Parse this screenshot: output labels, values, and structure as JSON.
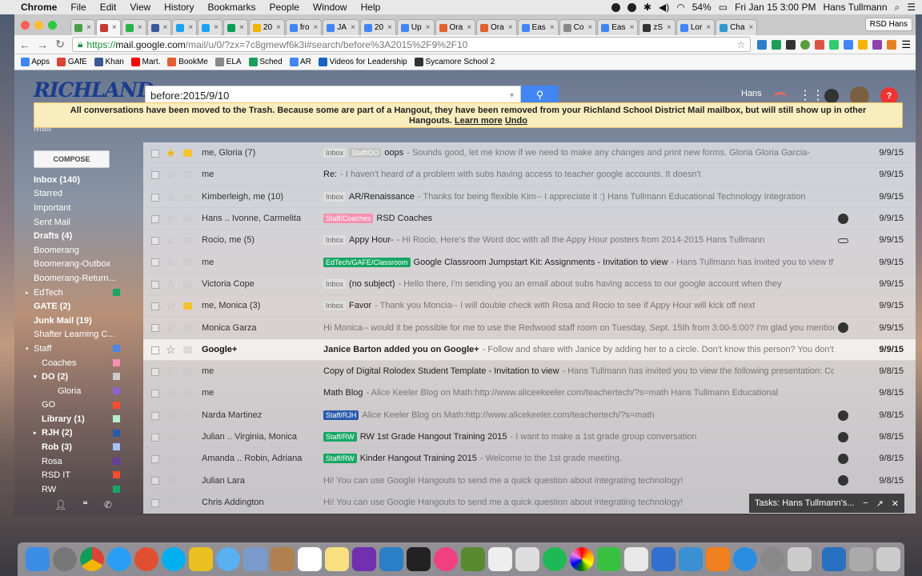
{
  "menubar": {
    "app": "Chrome",
    "items": [
      "File",
      "Edit",
      "View",
      "History",
      "Bookmarks",
      "People",
      "Window",
      "Help"
    ],
    "battery": "54%",
    "clock": "Fri Jan 15  3:00 PM",
    "user": "Hans Tullmann"
  },
  "tabs": [
    {
      "label": "",
      "color": "#4aa04a"
    },
    {
      "label": "",
      "color": "#c5392f"
    },
    {
      "label": "",
      "color": "#2bb24c"
    },
    {
      "label": "",
      "color": "#3b5998"
    },
    {
      "label": "",
      "color": "#1da1f2"
    },
    {
      "label": "",
      "color": "#1da1f2"
    },
    {
      "label": "",
      "color": "#0f9d58"
    },
    {
      "label": "20",
      "color": "#f4b400"
    },
    {
      "label": "fro",
      "color": "#4285f4"
    },
    {
      "label": "JA",
      "color": "#4285f4"
    },
    {
      "label": "20",
      "color": "#4285f4"
    },
    {
      "label": "Up",
      "color": "#4285f4"
    },
    {
      "label": "Ora",
      "color": "#e06030"
    },
    {
      "label": "Ora",
      "color": "#e06030"
    },
    {
      "label": "Eas",
      "color": "#4285f4"
    },
    {
      "label": "Co",
      "color": "#888"
    },
    {
      "label": "Eas",
      "color": "#4285f4"
    },
    {
      "label": "zS",
      "color": "#333"
    },
    {
      "label": "Lor",
      "color": "#4285f4"
    },
    {
      "label": "Cha",
      "color": "#3399cc"
    }
  ],
  "profile_button": "RSD Hans",
  "url": {
    "scheme": "https://",
    "host": "mail.google.com",
    "path": "/mail/u/0/?zx=7c8gmewf6k3i#search/before%3A2015%2F9%2F10"
  },
  "bookmarks": [
    "Apps",
    "GAfE",
    "Khan",
    "Mart.",
    "BookMe",
    "ELA",
    "Sched",
    "AR",
    "Videos for Leadership",
    "Sycamore School 2"
  ],
  "gmail": {
    "logo": "RICHLAND",
    "mail_word": "Mail",
    "search_value": "before:2015/9/10",
    "user_name": "Hans",
    "banner": {
      "text": "All conversations have been moved to the Trash. Because some are part of a Hangout, they have been removed from your Richland School District Mail mailbox, but will still show up in other Hangouts.",
      "learn": "Learn more",
      "undo": "Undo"
    },
    "compose": "COMPOSE",
    "labels": [
      {
        "name": "Inbox (140)",
        "bold": true
      },
      {
        "name": "Starred"
      },
      {
        "name": "Important"
      },
      {
        "name": "Sent Mail"
      },
      {
        "name": "Drafts (4)",
        "bold": true
      },
      {
        "name": "Boomerang"
      },
      {
        "name": "Boomerang-Outbox"
      },
      {
        "name": "Boomerang-Return..."
      },
      {
        "name": "EdTech",
        "color": "#16a765",
        "arrow": "▸"
      },
      {
        "name": "GATE (2)",
        "bold": true
      },
      {
        "name": "Junk Mail (19)",
        "bold": true
      },
      {
        "name": "Shafter Learning C..."
      },
      {
        "name": "Staff",
        "color": "#4986e7",
        "arrow": "▾"
      },
      {
        "name": "Coaches",
        "color": "#f691b2",
        "indent": 1
      },
      {
        "name": "DO (2)",
        "bold": true,
        "color": "#cccccc",
        "indent": 1,
        "arrow": "▾"
      },
      {
        "name": "Gloria",
        "color": "#8e63ce",
        "indent": 2
      },
      {
        "name": "GO",
        "color": "#fb4c2f",
        "indent": 1
      },
      {
        "name": "Library (1)",
        "bold": true,
        "color": "#b3efd3",
        "indent": 1
      },
      {
        "name": "RJH (2)",
        "bold": true,
        "color": "#285bac",
        "indent": 1,
        "arrow": "▸"
      },
      {
        "name": "Rob (3)",
        "bold": true,
        "color": "#a4c2f4",
        "indent": 1
      },
      {
        "name": "Rosa",
        "color": "#653e9b",
        "indent": 1
      },
      {
        "name": "RSD IT",
        "color": "#fb4c2f",
        "indent": 1
      },
      {
        "name": "RW",
        "color": "#16a765",
        "indent": 1
      }
    ],
    "emails": [
      {
        "sender": "me, Gloria (7)",
        "starred": true,
        "important": true,
        "tags": [
          {
            "text": "Inbox",
            "cls": "gray"
          },
          {
            "text": "Staff/DO",
            "cls": "lgray"
          }
        ],
        "subject": "oops",
        "snippet": " - Sounds good, let me know if we need to make any changes and print new forms. Gloria Gloria Garcia-",
        "date": "9/9/15"
      },
      {
        "sender": "me",
        "tags": [],
        "subject": "Re:",
        "snippet": " - I haven't heard of a problem with subs having access to teacher google accounts. It doesn't",
        "date": "9/9/15"
      },
      {
        "sender": "Kimberleigh, me (10)",
        "tags": [
          {
            "text": "Inbox",
            "cls": "gray"
          }
        ],
        "subject": "AR/Renaissance",
        "snippet": " - Thanks for being flexible Kim-- I appreciate it :) Hans Tullmann Educational Technology Integration",
        "date": "9/9/15"
      },
      {
        "sender": "Hans .. Ivonne, Carmelita",
        "tags": [
          {
            "text": "Staff/Coaches",
            "cls": "pink"
          }
        ],
        "subject": "RSD Coaches",
        "snippet": "",
        "date": "9/9/15",
        "att": "dot"
      },
      {
        "sender": "Rocio, me (5)",
        "tags": [
          {
            "text": "Inbox",
            "cls": "gray"
          }
        ],
        "subject": "Appy Hour-",
        "snippet": " - Hi Rocio, Here's the Word doc with all the Appy Hour posters from 2014-2015 Hans Tullmann",
        "date": "9/9/15",
        "att": "clip"
      },
      {
        "sender": "me",
        "tags": [
          {
            "text": "EdTech/GAFE/Classroom",
            "cls": "green"
          }
        ],
        "subject": "Google Classroom Jumpstart Kit: Assignments - Invitation to view",
        "snippet": " - Hans Tullmann has invited you to view the follo",
        "date": "9/9/15"
      },
      {
        "sender": "Victoria Cope",
        "tags": [
          {
            "text": "Inbox",
            "cls": "gray"
          }
        ],
        "subject": "(no subject)",
        "snippet": " - Hello there, I'm sending you an email about subs having access to our google account when they",
        "date": "9/9/15"
      },
      {
        "sender": "me, Monica (3)",
        "important": true,
        "tags": [
          {
            "text": "Inbox",
            "cls": "gray"
          }
        ],
        "subject": "Favor",
        "snippet": " - Thank you Moncia-- I will double check with Rosa and Rocio to see if Appy Hour will kick off next",
        "date": "9/9/15"
      },
      {
        "sender": "Monica Garza",
        "tags": [],
        "subject": "",
        "snippet": "Hi Monica-- would it be possible for me to use the Redwood staff room on Tuesday, Sept. 15th from 3:00-5:00?  I'm glad you mentioned the g",
        "date": "9/9/15",
        "att": "dot"
      },
      {
        "sender": "Google+",
        "unread": true,
        "tags": [],
        "subject": "Janice Barton added you on Google+",
        "snippet": " - Follow and share with Janice by adding her to a circle. Don't know this person? You don't",
        "date": "9/9/15"
      },
      {
        "sender": "me",
        "tags": [],
        "subject": "Copy of Digital Rolodex Student Template - Invitation to view",
        "snippet": " - Hans Tullmann has invited you to view the following presentation: Copy of Dig",
        "date": "9/8/15"
      },
      {
        "sender": "me",
        "tags": [],
        "subject": "Math Blog",
        "snippet": " - Alice Keeler Blog on Math:http://www.aliceekeeler.com/teachertech/?s=math Hans Tullmann Educational",
        "date": "9/8/15"
      },
      {
        "sender": "Narda Martinez",
        "tags": [
          {
            "text": "Staff/RJH",
            "cls": "blue"
          }
        ],
        "subject": "",
        "snippet": "Alice Keeler Blog on Math:http://www.alicekeeler.com/teachertech/?s=math",
        "date": "9/8/15",
        "att": "dot"
      },
      {
        "sender": "Julian .. Virginia, Monica",
        "tags": [
          {
            "text": "Staff/RW",
            "cls": "green"
          }
        ],
        "subject": "RW 1st Grade Hangout Training 2015",
        "snippet": " - I want to make a 1st grade group conversation",
        "date": "9/8/15",
        "att": "dot"
      },
      {
        "sender": "Amanda .. Robin, Adriana",
        "tags": [
          {
            "text": "Staff/RW",
            "cls": "green"
          }
        ],
        "subject": "Kinder Hangout Training 2015",
        "snippet": " - Welcome to the 1st grade meeting.",
        "date": "9/8/15",
        "att": "dot"
      },
      {
        "sender": "Julian Lara",
        "tags": [],
        "subject": "",
        "snippet": "Hi!  You can use Google Hangouts to send me a quick question about integrating technology!",
        "date": "9/8/15",
        "att": "dot"
      },
      {
        "sender": "Chris Addington",
        "tags": [],
        "subject": "",
        "snippet": "Hi!  You can use Google Hangouts to send me a quick question about integrating technology!",
        "date": "9/8/15"
      }
    ],
    "tasks_label": "Tasks: Hans Tullmann's..."
  },
  "tag_colors": {
    "pink": "#f691b2",
    "green": "#16a765",
    "blue": "#285bac"
  }
}
